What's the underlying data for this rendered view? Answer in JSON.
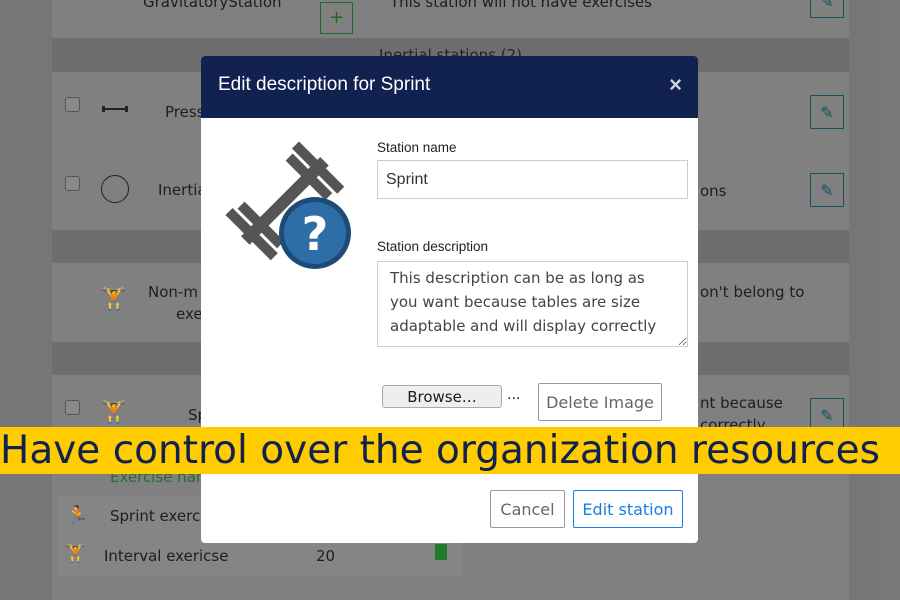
{
  "background": {
    "rows": [
      {
        "name": "GravitatoryStation",
        "description": "This station will not have exercises"
      },
      {
        "name": "Press",
        "description": ""
      },
      {
        "name": "Inertia",
        "description": "ons"
      },
      {
        "name": "Non-m",
        "name2": "exe",
        "description": "on't belong to"
      },
      {
        "name": "Sp",
        "description": "nt because",
        "description2": "correctly"
      }
    ],
    "section_header": "Inertial stations (2)",
    "exercise_header": "Exercise nan",
    "exercises": [
      {
        "name": "Sprint exercis",
        "value": ""
      },
      {
        "name": "Interval exericse",
        "value": "20"
      }
    ],
    "add_label": "+"
  },
  "modal": {
    "title": "Edit description for Sprint",
    "close": "×",
    "station_name_label": "Station name",
    "station_name_value": "Sprint",
    "station_description_label": "Station description",
    "station_description_value": "This description can be as long as you want because tables are size adaptable and will display correctly",
    "browse_label": "Browse…",
    "file_name": "...",
    "delete_image_label": "Delete Image",
    "cancel_label": "Cancel",
    "submit_label": "Edit station"
  },
  "banner": "Have control over the organization resources",
  "colors": {
    "modal_header": "#112150",
    "banner": "#ffcc00",
    "primary": "#1a7fe0",
    "edit": "#0e5560",
    "trash": "#1f7a2a"
  }
}
